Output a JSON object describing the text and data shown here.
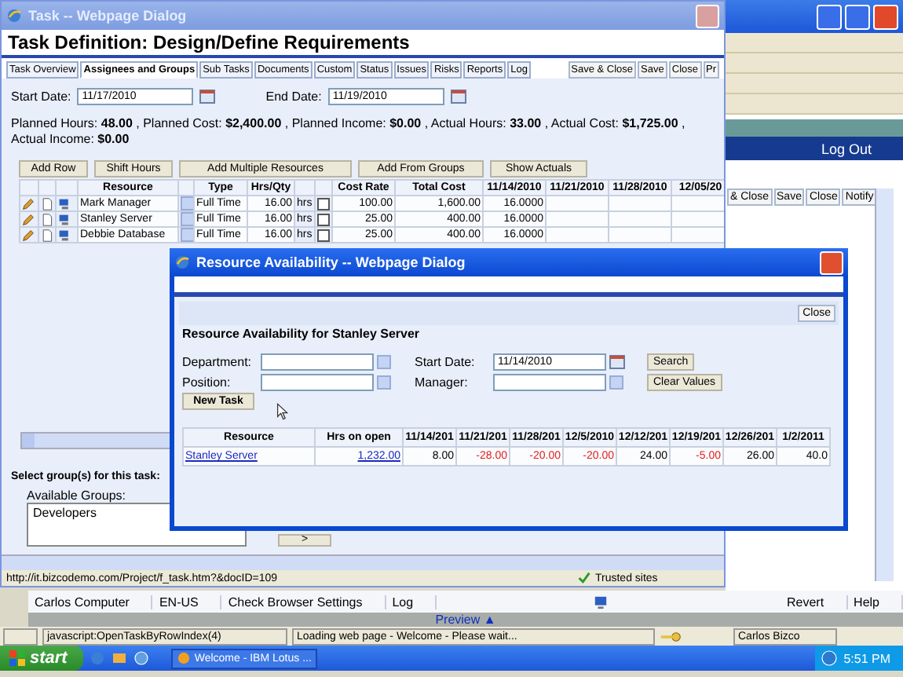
{
  "background_window": {
    "logout": "Log Out",
    "toolbar_buttons": [
      "& Close",
      "Save",
      "Close",
      "Notify"
    ]
  },
  "task_dialog": {
    "title": "Task -- Webpage Dialog",
    "heading": "Task Definition: Design/Define Requirements",
    "tabs": [
      {
        "label": "Task Overview",
        "selected": false
      },
      {
        "label": "Assignees and Groups",
        "selected": true
      },
      {
        "label": "Sub Tasks",
        "selected": false
      },
      {
        "label": "Documents",
        "selected": false
      },
      {
        "label": "Custom",
        "selected": false
      },
      {
        "label": "Status",
        "selected": false
      },
      {
        "label": "Issues",
        "selected": false
      },
      {
        "label": "Risks",
        "selected": false
      },
      {
        "label": "Reports",
        "selected": false
      },
      {
        "label": "Log",
        "selected": false
      }
    ],
    "actions": [
      "Save & Close",
      "Save",
      "Close",
      "Pr"
    ],
    "start_date": {
      "label": "Start Date:",
      "value": "11/17/2010"
    },
    "end_date": {
      "label": "End Date:",
      "value": "11/19/2010"
    },
    "summary": "Planned Hours:  **48.00** , Planned Cost: **$2,400.00** , Planned Income: **$0.00** , Actual Hours: **33.00** , Actual Cost: **$1,725.00** , Actual Income: **$0.00**",
    "grid_buttons": [
      "Add Row",
      "Shift Hours",
      "Add Multiple Resources",
      "Add From Groups",
      "Show Actuals"
    ],
    "columns": [
      "Resource",
      "Type",
      "Hrs/Qty",
      "Cost Rate",
      "Total Cost",
      "11/14/2010",
      "11/21/2010",
      "11/28/2010",
      "12/05/20"
    ],
    "rows": [
      {
        "resource": "Mark Manager",
        "type": "Full Time",
        "hrs": "16.00",
        "unit": "hrs",
        "checked": false,
        "cost_rate": "100.00",
        "total_cost": "1,600.00",
        "week_1": "16.0000"
      },
      {
        "resource": "Stanley Server",
        "type": "Full Time",
        "hrs": "16.00",
        "unit": "hrs",
        "checked": false,
        "cost_rate": "25.00",
        "total_cost": "400.00",
        "week_1": "16.0000"
      },
      {
        "resource": "Debbie Database",
        "type": "Full Time",
        "hrs": "16.00",
        "unit": "hrs",
        "checked": false,
        "cost_rate": "25.00",
        "total_cost": "400.00",
        "week_1": "16.0000"
      }
    ],
    "groups_label": "Select group(s) for this task:",
    "available_groups_label": "Available Groups:",
    "available_groups": [
      "Developers"
    ],
    "move_button": ">",
    "status_url": "http://it.bizcodemo.com/Project/f_task.htm?&docID=109",
    "zone": "Trusted sites"
  },
  "resource_dialog": {
    "title": "Resource Availability -- Webpage Dialog",
    "close_button": "Close",
    "heading": "Resource Availability for Stanley Server",
    "department_label": "Department:",
    "position_label": "Position:",
    "start_date_label": "Start Date:",
    "start_date": "11/14/2010",
    "manager_label": "Manager:",
    "search_button": "Search",
    "clear_button": "Clear Values",
    "new_task_button": "New Task",
    "columns": [
      "Resource",
      "Hrs on open",
      "11/14/201",
      "11/21/201",
      "11/28/201",
      "12/5/2010",
      "12/12/201",
      "12/19/201",
      "12/26/201",
      "1/2/2011"
    ],
    "rows": [
      {
        "resource": "Stanley Server",
        "hrs_on_open": "1,232.00",
        "weeks": [
          {
            "value": "8.00",
            "negative": false
          },
          {
            "value": "-28.00",
            "negative": true
          },
          {
            "value": "-20.00",
            "negative": true
          },
          {
            "value": "-20.00",
            "negative": true
          },
          {
            "value": "24.00",
            "negative": false
          },
          {
            "value": "-5.00",
            "negative": true
          },
          {
            "value": "26.00",
            "negative": false
          },
          {
            "value": "40.0",
            "negative": false
          }
        ]
      }
    ]
  },
  "lotus_bar": {
    "items": [
      "Carlos Computer",
      "EN-US",
      "Check Browser Settings",
      "Log"
    ],
    "right_items": [
      "Revert",
      "Help"
    ],
    "preview": "Preview",
    "preview_arrow": "▲"
  },
  "status_bar": {
    "url": "javascript:OpenTaskByRowIndex(4)",
    "message": "Loading web page - Welcome - Please wait...",
    "user": "Carlos Bizco"
  },
  "taskbar": {
    "start": "start",
    "task": "Welcome - IBM Lotus ...",
    "clock": "5:51 PM"
  }
}
